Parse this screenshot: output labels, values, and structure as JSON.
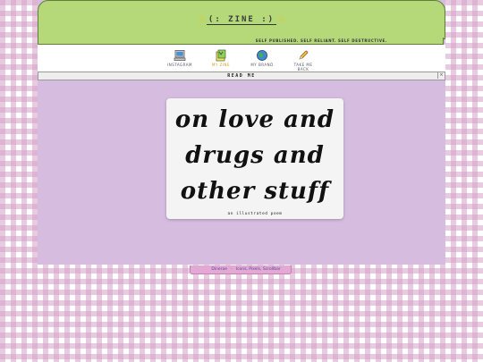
{
  "header": {
    "title": "(: ZINE :)",
    "tagline": "SELF PUBLISHED. SELF RELIANT. SELF DESTRUCTIVE."
  },
  "nav": {
    "items": [
      {
        "label": "INSTAGRAM",
        "icon": "computer-icon",
        "active": false
      },
      {
        "label": "MY ZINE",
        "icon": "zine-icon",
        "active": true
      },
      {
        "label": "MY BRAND",
        "icon": "globe-icon",
        "active": false
      },
      {
        "label": "TAKE ME BACK",
        "icon": "pencil-icon",
        "active": false
      }
    ]
  },
  "reader": {
    "title": "READ ME",
    "close": "×"
  },
  "cover": {
    "line1": "on love and",
    "line2": "drugs and",
    "line3": "other stuff",
    "caption": "an illustrated poem"
  },
  "footer": {
    "link1": "Dinerae",
    "separator": "-",
    "link2": "Icons, Pixels, Scrollbar"
  },
  "colors": {
    "header_green": "#b5d879",
    "page_lavender": "#d6bde0",
    "checker_pink": "#d6a0c8",
    "footer_pink": "#e4a8d4"
  }
}
